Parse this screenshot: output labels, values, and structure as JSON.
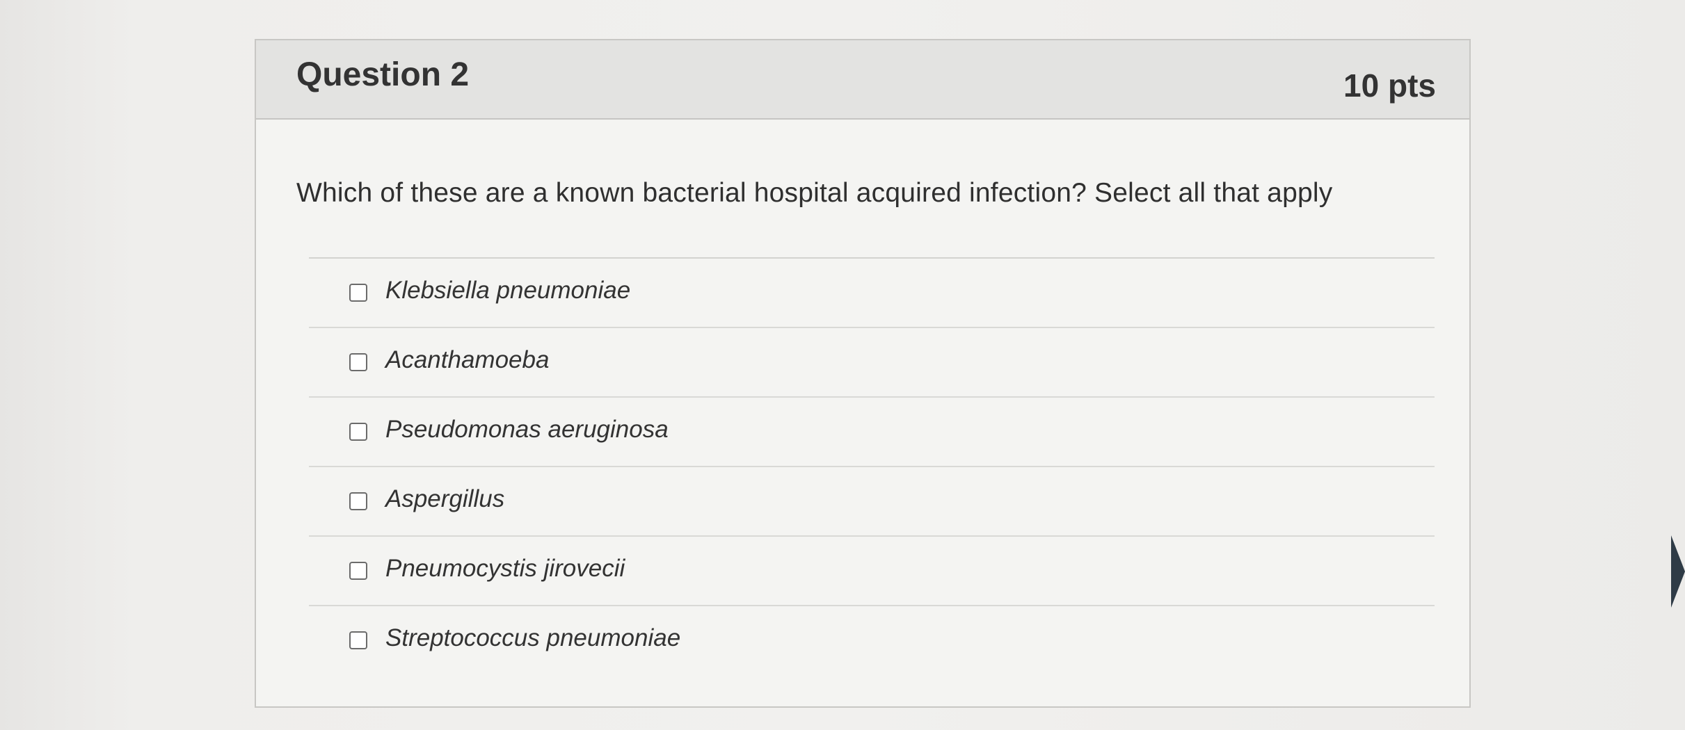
{
  "question": {
    "title": "Question 2",
    "points": "10 pts",
    "prompt": "Which of these are a known bacterial hospital acquired infection?  Select all that apply",
    "options": [
      {
        "label": "Klebsiella pneumoniae",
        "checked": false
      },
      {
        "label": "Acanthamoeba",
        "checked": false
      },
      {
        "label": "Pseudomonas aeruginosa",
        "checked": false
      },
      {
        "label": "Aspergillus",
        "checked": false
      },
      {
        "label": "Pneumocystis jirovecii",
        "checked": false
      },
      {
        "label": "Streptococcus pneumoniae",
        "checked": false
      }
    ]
  },
  "colors": {
    "header_bg": "#e3e3e1",
    "card_bg": "#f4f4f2",
    "border": "#c8c7c4",
    "text": "#333333"
  },
  "icons": {
    "side_arrow": "chevron-right-icon"
  }
}
